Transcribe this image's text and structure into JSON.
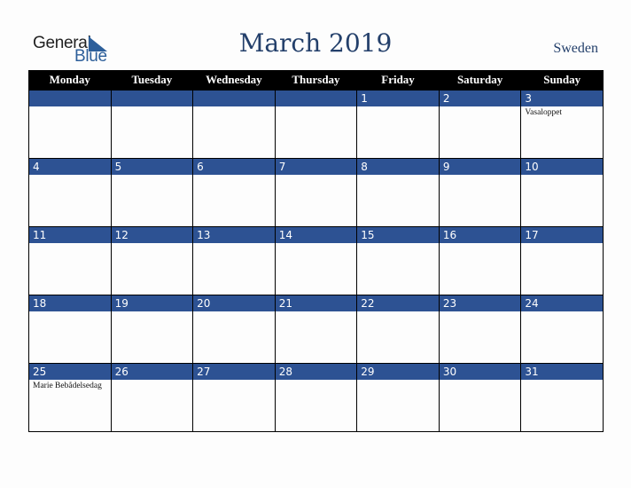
{
  "brand": {
    "line1": "General",
    "line2": "Blue",
    "accent": "#2d5f9a"
  },
  "header": {
    "title": "March 2019",
    "country": "Sweden"
  },
  "colors": {
    "title": "#24406b",
    "band": "#2d5293",
    "header_bg": "#000000"
  },
  "days_of_week": [
    "Monday",
    "Tuesday",
    "Wednesday",
    "Thursday",
    "Friday",
    "Saturday",
    "Sunday"
  ],
  "weeks": [
    [
      {
        "day": "",
        "event": ""
      },
      {
        "day": "",
        "event": ""
      },
      {
        "day": "",
        "event": ""
      },
      {
        "day": "",
        "event": ""
      },
      {
        "day": "1",
        "event": ""
      },
      {
        "day": "2",
        "event": ""
      },
      {
        "day": "3",
        "event": "Vasaloppet"
      }
    ],
    [
      {
        "day": "4",
        "event": ""
      },
      {
        "day": "5",
        "event": ""
      },
      {
        "day": "6",
        "event": ""
      },
      {
        "day": "7",
        "event": ""
      },
      {
        "day": "8",
        "event": ""
      },
      {
        "day": "9",
        "event": ""
      },
      {
        "day": "10",
        "event": ""
      }
    ],
    [
      {
        "day": "11",
        "event": ""
      },
      {
        "day": "12",
        "event": ""
      },
      {
        "day": "13",
        "event": ""
      },
      {
        "day": "14",
        "event": ""
      },
      {
        "day": "15",
        "event": ""
      },
      {
        "day": "16",
        "event": ""
      },
      {
        "day": "17",
        "event": ""
      }
    ],
    [
      {
        "day": "18",
        "event": ""
      },
      {
        "day": "19",
        "event": ""
      },
      {
        "day": "20",
        "event": ""
      },
      {
        "day": "21",
        "event": ""
      },
      {
        "day": "22",
        "event": ""
      },
      {
        "day": "23",
        "event": ""
      },
      {
        "day": "24",
        "event": ""
      }
    ],
    [
      {
        "day": "25",
        "event": "Marie Bebådelsedag"
      },
      {
        "day": "26",
        "event": ""
      },
      {
        "day": "27",
        "event": ""
      },
      {
        "day": "28",
        "event": ""
      },
      {
        "day": "29",
        "event": ""
      },
      {
        "day": "30",
        "event": ""
      },
      {
        "day": "31",
        "event": ""
      }
    ]
  ]
}
